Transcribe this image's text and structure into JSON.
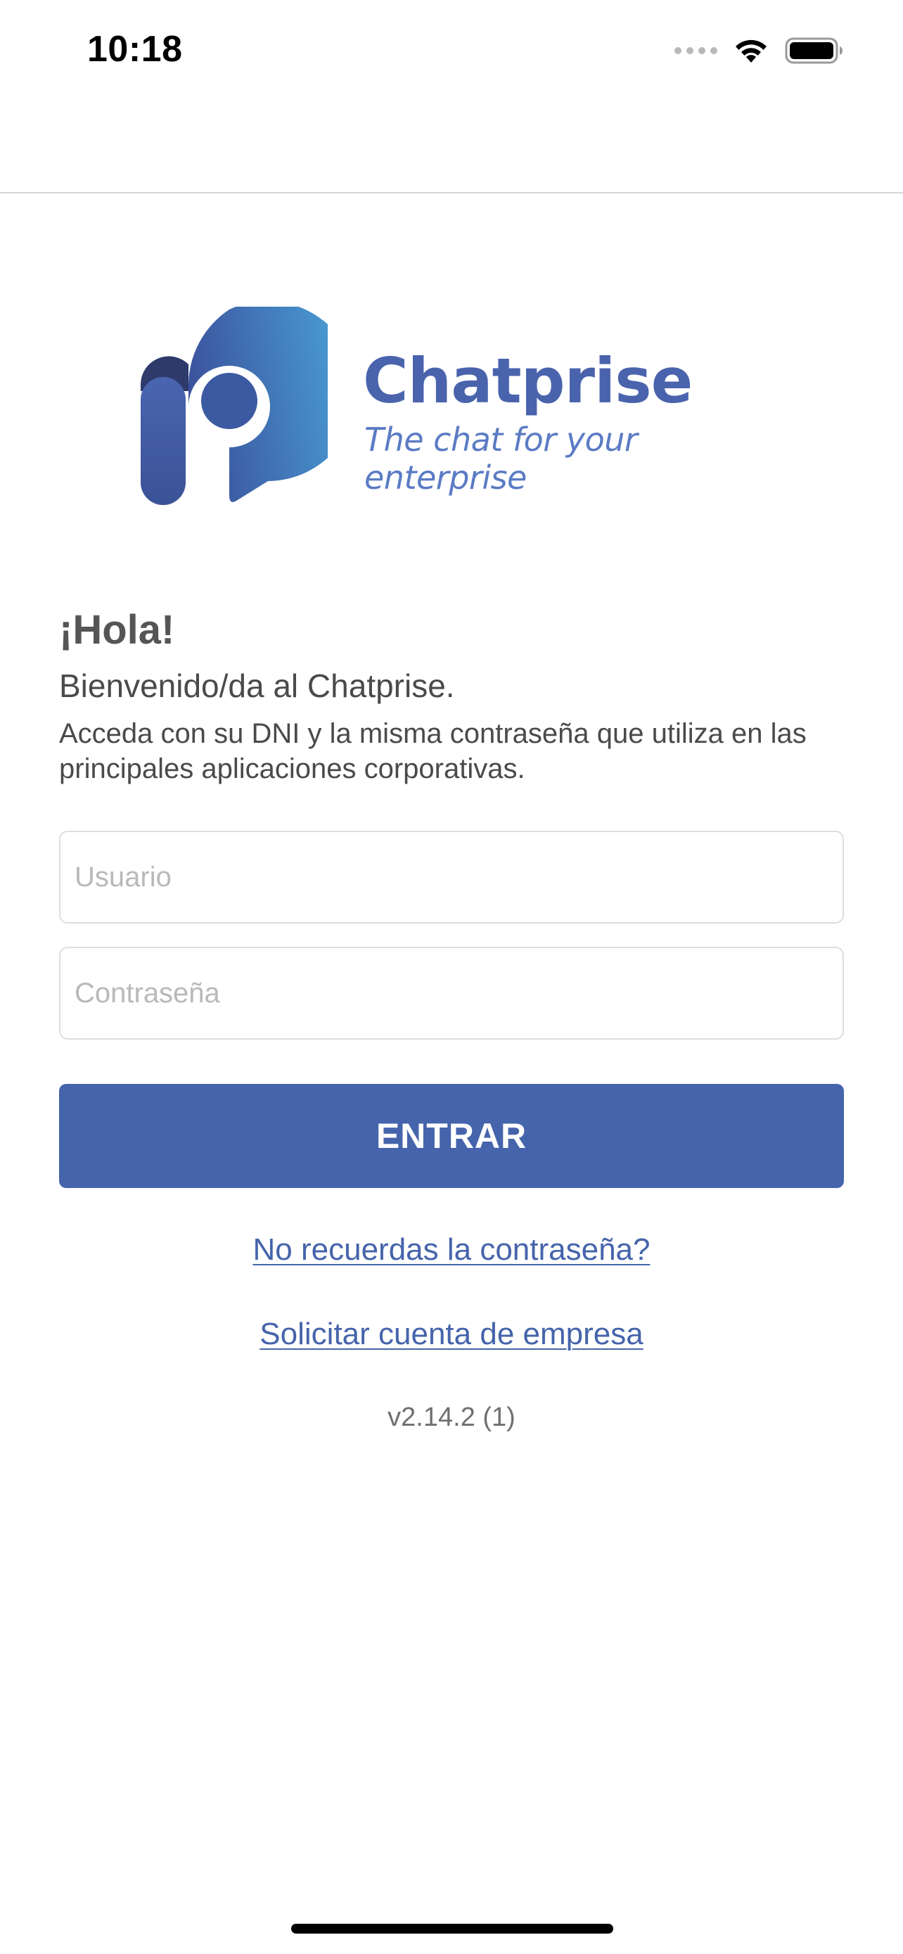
{
  "status_bar": {
    "time": "10:18",
    "signal_icon": "cellular-signal-dots-icon",
    "wifi_icon": "wifi-icon",
    "battery_icon": "battery-full-icon"
  },
  "brand": {
    "name": "Chatprise",
    "tagline": "The chat for your enterprise",
    "logo_icon": "chatprise-p-logo-icon",
    "colors": {
      "primary": "#4564ab",
      "gradient_start": "#3a5aa8",
      "gradient_end": "#4aa0d8"
    }
  },
  "intro": {
    "greeting": "¡Hola!",
    "welcome": "Bienvenido/da al Chatprise.",
    "instructions": "Acceda con su DNI y la misma contraseña que utiliza en las principales aplicaciones corporativas."
  },
  "form": {
    "username": {
      "value": "",
      "placeholder": "Usuario"
    },
    "password": {
      "value": "",
      "placeholder": "Contraseña"
    },
    "submit_label": "ENTRAR"
  },
  "links": {
    "forgot_password": "No recuerdas la contraseña?",
    "request_account": "Solicitar cuenta de empresa"
  },
  "version": "v2.14.2 (1)"
}
